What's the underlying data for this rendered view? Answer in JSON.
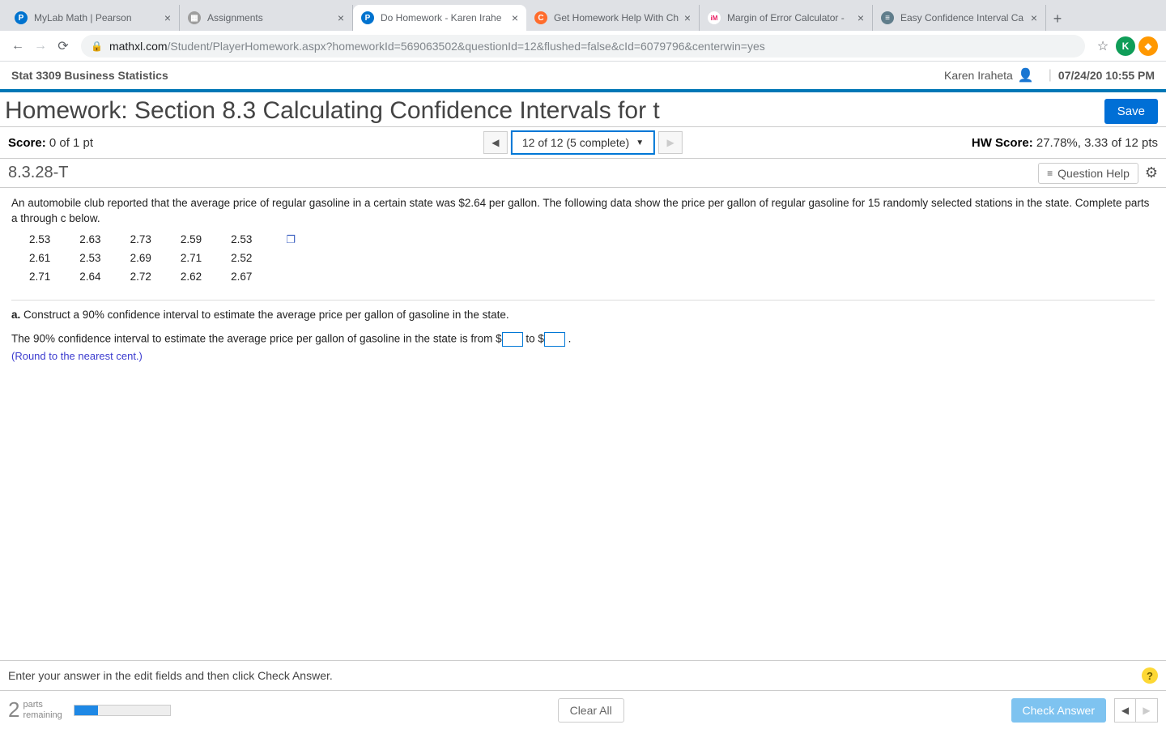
{
  "browser": {
    "tabs": [
      {
        "label": "MyLab Math | Pearson",
        "favcolor": "#0073cf",
        "favtext": "P"
      },
      {
        "label": "Assignments",
        "favcolor": "#9e9e9e",
        "favtext": "▦"
      },
      {
        "label": "Do Homework - Karen Irahe",
        "favcolor": "#0073cf",
        "favtext": "P",
        "active": true
      },
      {
        "label": "Get Homework Help With Ch",
        "favcolor": "#ff6c2c",
        "favtext": "C"
      },
      {
        "label": "Margin of Error Calculator -",
        "favcolor": "#e91e63",
        "favtext": "iM"
      },
      {
        "label": "Easy Confidence Interval Ca",
        "favcolor": "#607d8b",
        "favtext": "≡"
      }
    ],
    "url_host": "mathxl.com",
    "url_path": "/Student/PlayerHomework.aspx?homeworkId=569063502&questionId=12&flushed=false&cId=6079796&centerwin=yes",
    "avatar": "K"
  },
  "header": {
    "course": "Stat 3309 Business Statistics",
    "user": "Karen Iraheta",
    "datetime": "07/24/20 10:55 PM"
  },
  "title": "Homework: Section 8.3 Calculating Confidence Intervals for t",
  "save_label": "Save",
  "score": {
    "label": "Score:",
    "value": "0 of 1 pt"
  },
  "nav": {
    "position": "12 of 12 (5 complete)"
  },
  "hwscore": {
    "label": "HW Score:",
    "value": "27.78%, 3.33 of 12 pts"
  },
  "question_id": "8.3.28-T",
  "question_help": "Question Help",
  "problem": {
    "prompt": "An automobile club reported that the average price of regular gasoline in a certain state was $2.64 per gallon. The following data show the price per gallon of regular gasoline for 15 randomly selected stations in the state. Complete parts a through c below.",
    "data": [
      [
        "2.53",
        "2.63",
        "2.73",
        "2.59",
        "2.53"
      ],
      [
        "2.61",
        "2.53",
        "2.69",
        "2.71",
        "2.52"
      ],
      [
        "2.71",
        "2.64",
        "2.72",
        "2.62",
        "2.67"
      ]
    ],
    "part_a_label": "a.",
    "part_a_text": "Construct a 90% confidence interval to estimate the average price per gallon of gasoline in the state.",
    "answer_pre": "The 90% confidence interval to estimate the average price per gallon of gasoline in the state is from $",
    "answer_mid": " to $",
    "answer_post": " .",
    "round_note": "(Round to the nearest cent.)"
  },
  "footer": {
    "instruction": "Enter your answer in the edit fields and then click Check Answer.",
    "parts_number": "2",
    "parts_label_top": "parts",
    "parts_label_bot": "remaining",
    "clear": "Clear All",
    "check": "Check Answer"
  }
}
